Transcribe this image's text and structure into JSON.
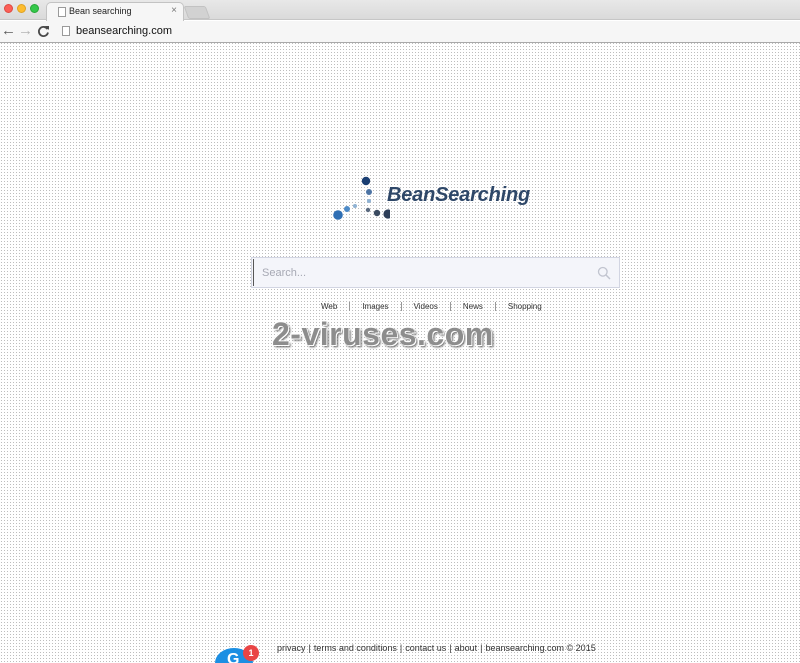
{
  "browser": {
    "tab_title": "Bean searching",
    "tab_close": "×",
    "url": "beansearching.com",
    "nav": {
      "back_icon": "←",
      "forward_icon": "→",
      "reload_icon": "C"
    }
  },
  "logo": {
    "text": "BeanSearching",
    "colors": [
      "#1b3f73",
      "#4d74a4",
      "#8fb2d3",
      "#2d3e58"
    ]
  },
  "search": {
    "placeholder": "Search...",
    "value": ""
  },
  "search_tabs": [
    "Web",
    "Images",
    "Videos",
    "News",
    "Shopping"
  ],
  "watermark": "2-viruses.com",
  "footer": {
    "links": [
      "privacy",
      "terms and conditions",
      "contact us",
      "about"
    ],
    "copyright": "beansearching.com © 2015"
  },
  "chat": {
    "badge_count": "1",
    "letter": "G"
  },
  "colors": {
    "accent": "#2e4768",
    "search_bg": "#f4f5fa",
    "chat_blue": "#1c8fe3",
    "badge_red": "#e94545"
  }
}
